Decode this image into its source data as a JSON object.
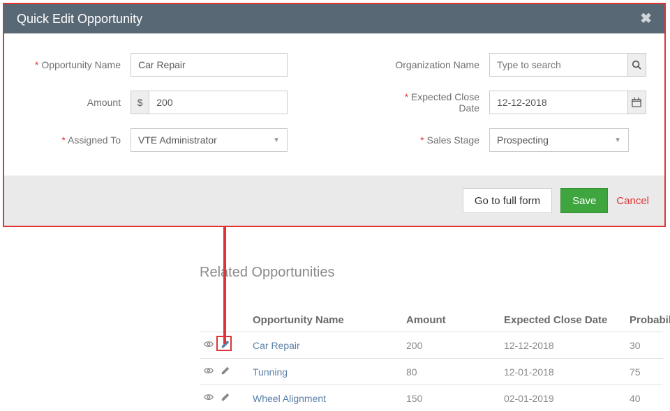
{
  "modal": {
    "title": "Quick Edit Opportunity",
    "labels": {
      "opportunity_name": "Opportunity Name",
      "organization_name": "Organization Name",
      "amount": "Amount",
      "expected_close_date": "Expected Close Date",
      "assigned_to": "Assigned To",
      "sales_stage": "Sales Stage"
    },
    "values": {
      "opportunity_name": "Car Repair",
      "amount": "200",
      "amount_prefix": "$",
      "expected_close_date": "12-12-2018",
      "assigned_to": "VTE Administrator",
      "sales_stage": "Prospecting"
    },
    "placeholders": {
      "organization_name": "Type to search"
    },
    "footer": {
      "full_form": "Go to full form",
      "save": "Save",
      "cancel": "Cancel"
    }
  },
  "related": {
    "title": "Related Opportunities",
    "columns": {
      "name": "Opportunity Name",
      "amount": "Amount",
      "close_date": "Expected Close Date",
      "probability": "Probability"
    },
    "rows": [
      {
        "name": "Car Repair",
        "amount": "200",
        "close_date": "12-12-2018",
        "probability": "30"
      },
      {
        "name": "Tunning",
        "amount": "80",
        "close_date": "12-01-2018",
        "probability": "75"
      },
      {
        "name": "Wheel Alignment",
        "amount": "150",
        "close_date": "02-01-2019",
        "probability": "40"
      }
    ]
  }
}
